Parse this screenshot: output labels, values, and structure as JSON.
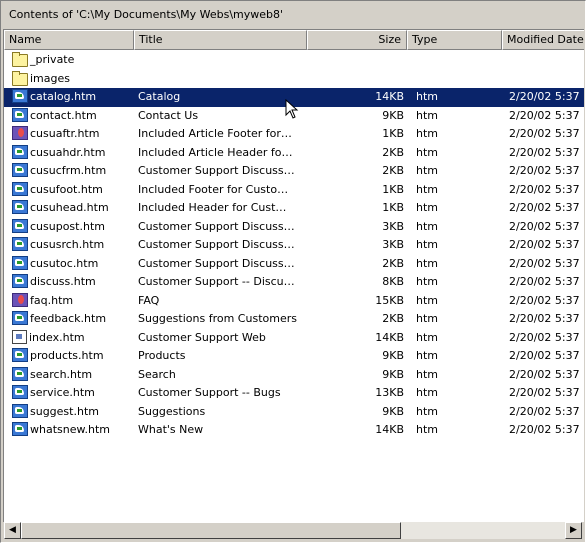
{
  "caption": "Contents of 'C:\\My Documents\\My Webs\\myweb8'",
  "columns": {
    "name": "Name",
    "title": "Title",
    "size": "Size",
    "type": "Type",
    "modified": "Modified Date"
  },
  "rows": [
    {
      "name": "_private",
      "title": "",
      "size": "",
      "type": "",
      "modified": "",
      "icon": "folder-icon"
    },
    {
      "name": "images",
      "title": "",
      "size": "",
      "type": "",
      "modified": "",
      "icon": "folder-icon"
    },
    {
      "name": "catalog.htm",
      "title": "Catalog",
      "size": "14KB",
      "type": "htm",
      "modified": "2/20/02 5:37",
      "icon": "html-page-icon",
      "selected": true
    },
    {
      "name": "contact.htm",
      "title": "Contact Us",
      "size": "9KB",
      "type": "htm",
      "modified": "2/20/02 5:37",
      "icon": "html-page-icon"
    },
    {
      "name": "cusuaftr.htm",
      "title": "Included Article Footer for…",
      "size": "1KB",
      "type": "htm",
      "modified": "2/20/02 5:37",
      "icon": "special-page-icon"
    },
    {
      "name": "cusuahdr.htm",
      "title": "Included Article Header fo…",
      "size": "2KB",
      "type": "htm",
      "modified": "2/20/02 5:37",
      "icon": "html-page-icon"
    },
    {
      "name": "cusucfrm.htm",
      "title": "Customer Support Discuss…",
      "size": "2KB",
      "type": "htm",
      "modified": "2/20/02 5:37",
      "icon": "html-page-icon"
    },
    {
      "name": "cusufoot.htm",
      "title": "Included Footer for Custo…",
      "size": "1KB",
      "type": "htm",
      "modified": "2/20/02 5:37",
      "icon": "html-page-icon"
    },
    {
      "name": "cusuhead.htm",
      "title": "Included Header for Cust…",
      "size": "1KB",
      "type": "htm",
      "modified": "2/20/02 5:37",
      "icon": "html-page-icon"
    },
    {
      "name": "cusupost.htm",
      "title": "Customer Support Discuss…",
      "size": "3KB",
      "type": "htm",
      "modified": "2/20/02 5:37",
      "icon": "html-page-icon"
    },
    {
      "name": "cususrch.htm",
      "title": "Customer Support Discuss…",
      "size": "3KB",
      "type": "htm",
      "modified": "2/20/02 5:37",
      "icon": "html-page-icon"
    },
    {
      "name": "cusutoc.htm",
      "title": "Customer Support Discuss…",
      "size": "2KB",
      "type": "htm",
      "modified": "2/20/02 5:37",
      "icon": "html-page-icon"
    },
    {
      "name": "discuss.htm",
      "title": "Customer Support -- Discu…",
      "size": "8KB",
      "type": "htm",
      "modified": "2/20/02 5:37",
      "icon": "html-page-icon"
    },
    {
      "name": "faq.htm",
      "title": "FAQ",
      "size": "15KB",
      "type": "htm",
      "modified": "2/20/02 5:37",
      "icon": "special-page-icon"
    },
    {
      "name": "feedback.htm",
      "title": "Suggestions from Customers",
      "size": "2KB",
      "type": "htm",
      "modified": "2/20/02 5:37",
      "icon": "html-page-icon"
    },
    {
      "name": "index.htm",
      "title": "Customer Support Web",
      "size": "14KB",
      "type": "htm",
      "modified": "2/20/02 5:37",
      "icon": "home-page-icon"
    },
    {
      "name": "products.htm",
      "title": "Products",
      "size": "9KB",
      "type": "htm",
      "modified": "2/20/02 5:37",
      "icon": "html-page-icon"
    },
    {
      "name": "search.htm",
      "title": "Search",
      "size": "9KB",
      "type": "htm",
      "modified": "2/20/02 5:37",
      "icon": "html-page-icon"
    },
    {
      "name": "service.htm",
      "title": "Customer Support -- Bugs",
      "size": "13KB",
      "type": "htm",
      "modified": "2/20/02 5:37",
      "icon": "html-page-icon"
    },
    {
      "name": "suggest.htm",
      "title": "Suggestions",
      "size": "9KB",
      "type": "htm",
      "modified": "2/20/02 5:37",
      "icon": "html-page-icon"
    },
    {
      "name": "whatsnew.htm",
      "title": "What's New",
      "size": "14KB",
      "type": "htm",
      "modified": "2/20/02 5:37",
      "icon": "html-page-icon"
    }
  ],
  "scrollbar": {
    "left_arrow": "◀",
    "right_arrow": "▶"
  },
  "colors": {
    "selection": "#0a246a",
    "chrome": "#d4d0c8"
  }
}
